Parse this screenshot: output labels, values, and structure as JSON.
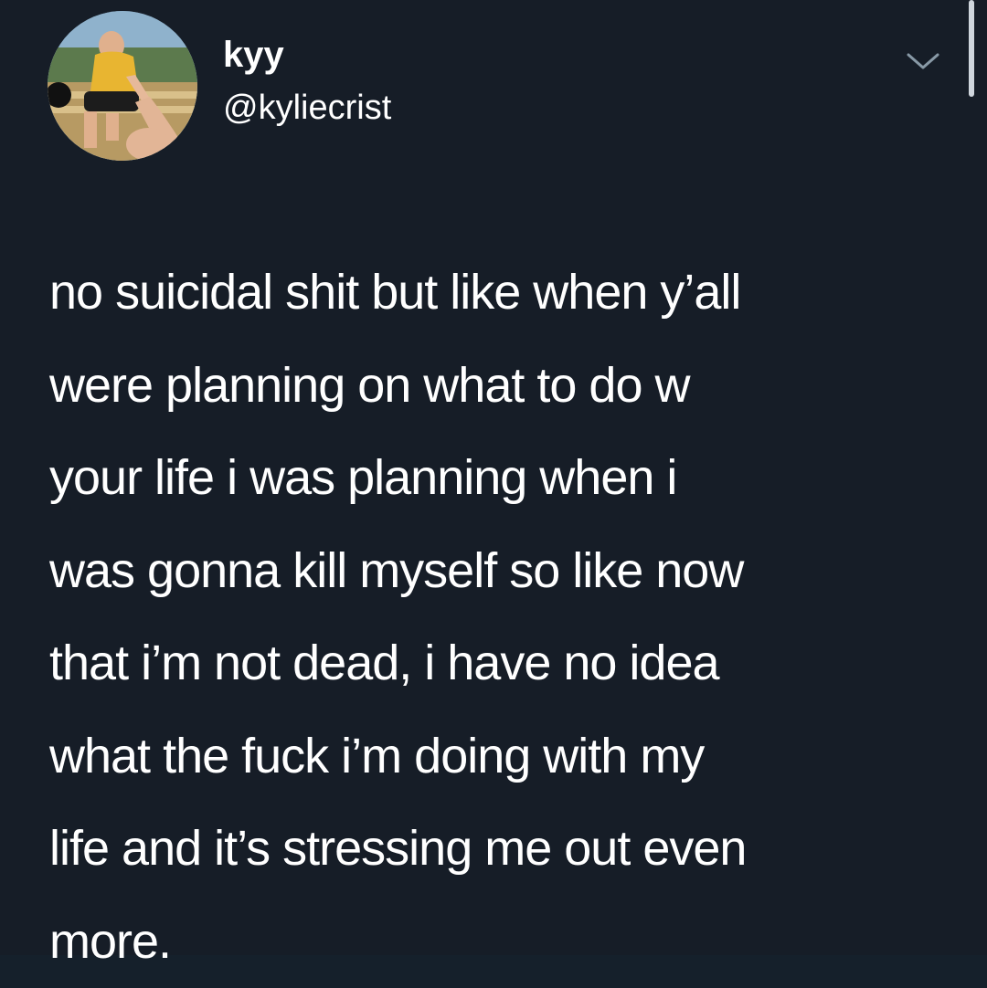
{
  "tweet": {
    "author": {
      "display_name": "kyy",
      "handle": "@kyliecrist",
      "avatar": "profile-photo"
    },
    "menu_icon": "chevron-down-icon",
    "text_lines": [
      "no suicidal shit but like when y’all",
      "were planning on what to do w",
      "your life i was planning when i",
      "was gonna kill myself so like now",
      "that i’m not dead, i have no idea",
      "what the fuck i’m doing with my",
      "life and it’s stressing me out even",
      "more."
    ]
  },
  "colors": {
    "background": "#161d27",
    "text": "#ffffff",
    "secondary": "#8899a6"
  }
}
